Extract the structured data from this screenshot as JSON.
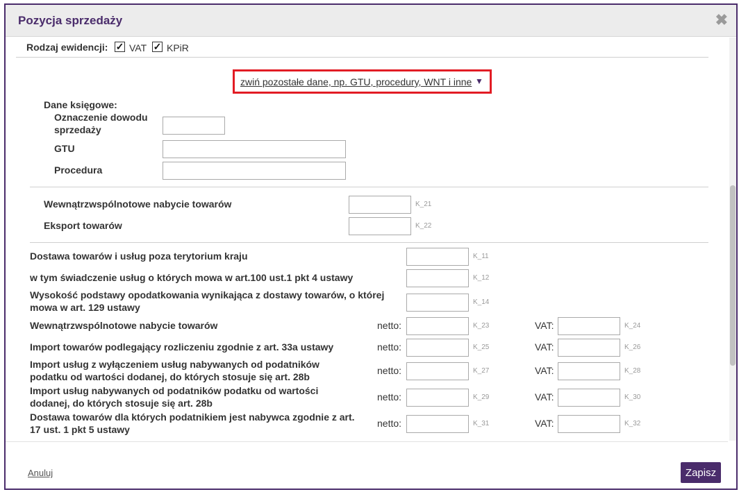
{
  "dialog": {
    "title": "Pozycja sprzedaży",
    "close_icon": "close-icon"
  },
  "record_type": {
    "label": "Rodzaj ewidencji:",
    "options": [
      {
        "label": "VAT",
        "checked": true
      },
      {
        "label": "KPiR",
        "checked": true
      }
    ]
  },
  "toggle": {
    "label": "zwiń pozostałe dane, np. GTU, procedury, WNT i inne",
    "arrow": "▼"
  },
  "accounting": {
    "heading": "Dane księgowe:",
    "sale_doc_label": "Oznaczenie dowodu sprzedaży",
    "gtu_label": "GTU",
    "procedure_label": "Procedura"
  },
  "kpir_section": {
    "wnt_label": "Wewnątrzwspólnotowe nabycie towarów",
    "wnt_code": "K_21",
    "export_label": "Eksport towarów",
    "export_code": "K_22"
  },
  "vat_rows": [
    {
      "label": "Dostawa towarów i usług poza terytorium kraju",
      "code": "K_11"
    },
    {
      "label": "w tym świadczenie usług o których mowa w art.100 ust.1 pkt 4 ustawy",
      "code": "K_12"
    },
    {
      "label": "Wysokość podstawy opodatkowania wynikająca z dostawy towarów, o której mowa w art. 129 ustawy",
      "code": "K_14"
    }
  ],
  "netto_vat_rows": [
    {
      "label": "Wewnątrzwspólnotowe nabycie towarów",
      "netto_code": "K_23",
      "vat_code": "K_24"
    },
    {
      "label": "Import towarów podlegający rozliczeniu zgodnie z art. 33a ustawy",
      "netto_code": "K_25",
      "vat_code": "K_26"
    },
    {
      "label": "Import usług z wyłączeniem usług nabywanych od podatników podatku od wartości dodanej, do których stosuje się art. 28b",
      "netto_code": "K_27",
      "vat_code": "K_28"
    },
    {
      "label": "Import usług nabywanych od podatników podatku od wartości dodanej, do których stosuje się art. 28b",
      "netto_code": "K_29",
      "vat_code": "K_30"
    },
    {
      "label": "Dostawa towarów dla których podatnikiem jest nabywca zgodnie z art. 17 ust. 1 pkt 5 ustawy",
      "netto_code": "K_31",
      "vat_code": "K_32"
    }
  ],
  "labels": {
    "netto": "netto:",
    "vat": "VAT:"
  },
  "footer": {
    "cancel": "Anuluj",
    "save": "Zapisz"
  },
  "colors": {
    "accent": "#4a2c6b",
    "highlight": "#e21c24"
  }
}
